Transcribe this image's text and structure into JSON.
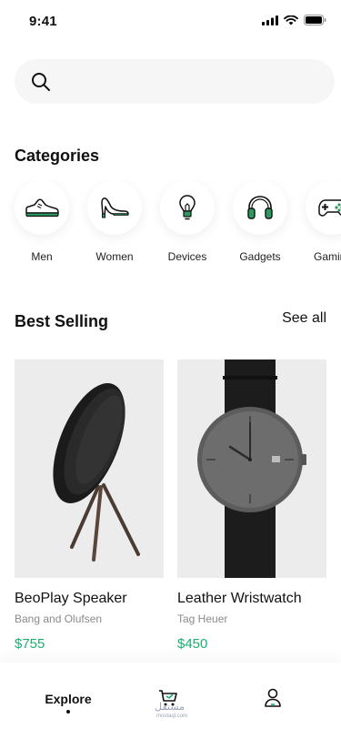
{
  "status_bar": {
    "time": "9:41"
  },
  "search": {
    "placeholder": "",
    "value": ""
  },
  "categories": {
    "title": "Categories",
    "items": [
      {
        "label": "Men",
        "icon": "sneaker-icon"
      },
      {
        "label": "Women",
        "icon": "high-heel-icon"
      },
      {
        "label": "Devices",
        "icon": "lightbulb-icon"
      },
      {
        "label": "Gadgets",
        "icon": "headphones-icon"
      },
      {
        "label": "Gaming",
        "icon": "gamepad-icon"
      }
    ]
  },
  "best_selling": {
    "title": "Best Selling",
    "see_all": "See all",
    "products": [
      {
        "name": "BeoPlay Speaker",
        "brand": "Bang and Olufsen",
        "price": "$755"
      },
      {
        "name": "Leather Wristwatch",
        "brand": "Tag Heuer",
        "price": "$450"
      }
    ]
  },
  "tab_bar": {
    "explore": "Explore",
    "watermark": "مستقل",
    "watermark_sub": "mostaql.com"
  },
  "colors": {
    "accent_green": "#1aae72",
    "price_green": "#1aae72"
  }
}
